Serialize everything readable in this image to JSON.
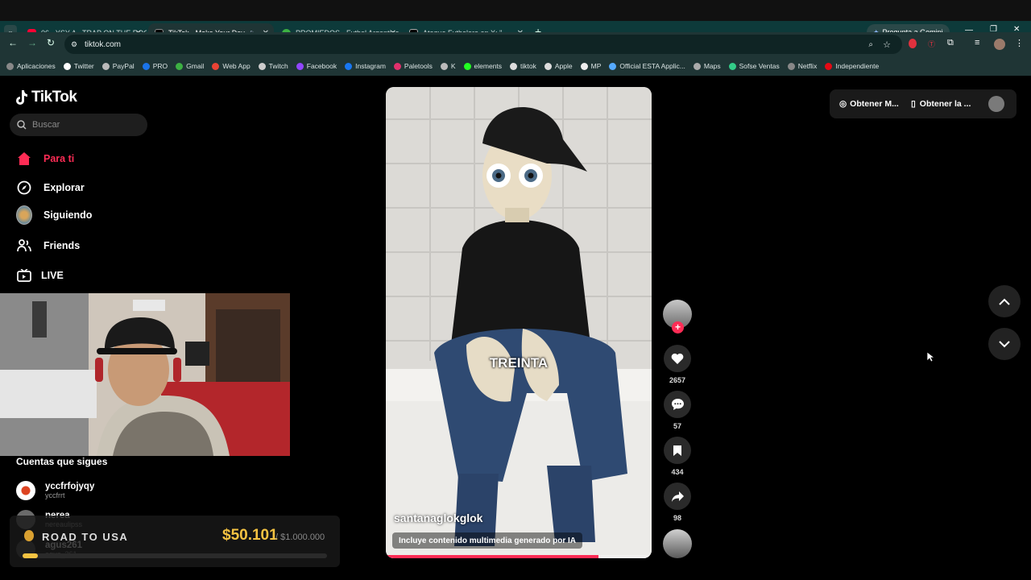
{
  "browser": {
    "tabs": [
      {
        "label": "06 - YSY A - TRAP ON THE ROC",
        "color": "#ff0033"
      },
      {
        "label": "TikTok - Make Your Day",
        "color": "#ffffff"
      },
      {
        "label": "PROMIEDOS - Futbol Argentino",
        "color": "#3cb043"
      },
      {
        "label": "Ataque Futbolero en X: \"",
        "color": "#cccccc"
      }
    ],
    "url": "tiktok.com",
    "gemini": "Pregunta a Gemini",
    "bookmarks": [
      "Aplicaciones",
      "Twitter",
      "PayPal",
      "PRO",
      "Gmail",
      "Web App",
      "Twitch",
      "Facebook",
      "Instagram",
      "Paletools",
      "K",
      "elements",
      "tiktok",
      "Apple",
      "MP",
      "Official ESTA Applic...",
      "Maps",
      "Sofse Ventas",
      "Netflix",
      "Independiente"
    ]
  },
  "sidebar": {
    "logo": "TikTok",
    "search_placeholder": "Buscar",
    "nav": [
      {
        "label": "Para ti",
        "active": true
      },
      {
        "label": "Explorar"
      },
      {
        "label": "Siguiendo"
      },
      {
        "label": "Friends"
      },
      {
        "label": "LIVE"
      }
    ],
    "following_title": "Cuentas que sigues",
    "accounts": [
      {
        "name": "yccfrfojyqy",
        "user": "yccfrrt"
      },
      {
        "name": "nerea",
        "user": "nereaulipss"
      },
      {
        "name": "agus261",
        "user": "agus_261"
      }
    ]
  },
  "overlay": {
    "title": "ROAD TO USA",
    "amount": "$50.101",
    "goal": "/ $1.000.000",
    "progress_fraction": 0.05
  },
  "video": {
    "caption_word": "TREINTA",
    "author": "santanaglokglok",
    "ai_label": "Incluye contenido multimedia generado por IA",
    "progress_fraction": 0.8
  },
  "actions": {
    "likes": "2657",
    "comments": "57",
    "saves": "434",
    "shares": "98"
  },
  "top": {
    "btn1": "Obtener M...",
    "btn2": "Obtener la ..."
  },
  "colors": {
    "accent": "#fe2c55",
    "overlay_gold": "#f5c342"
  }
}
